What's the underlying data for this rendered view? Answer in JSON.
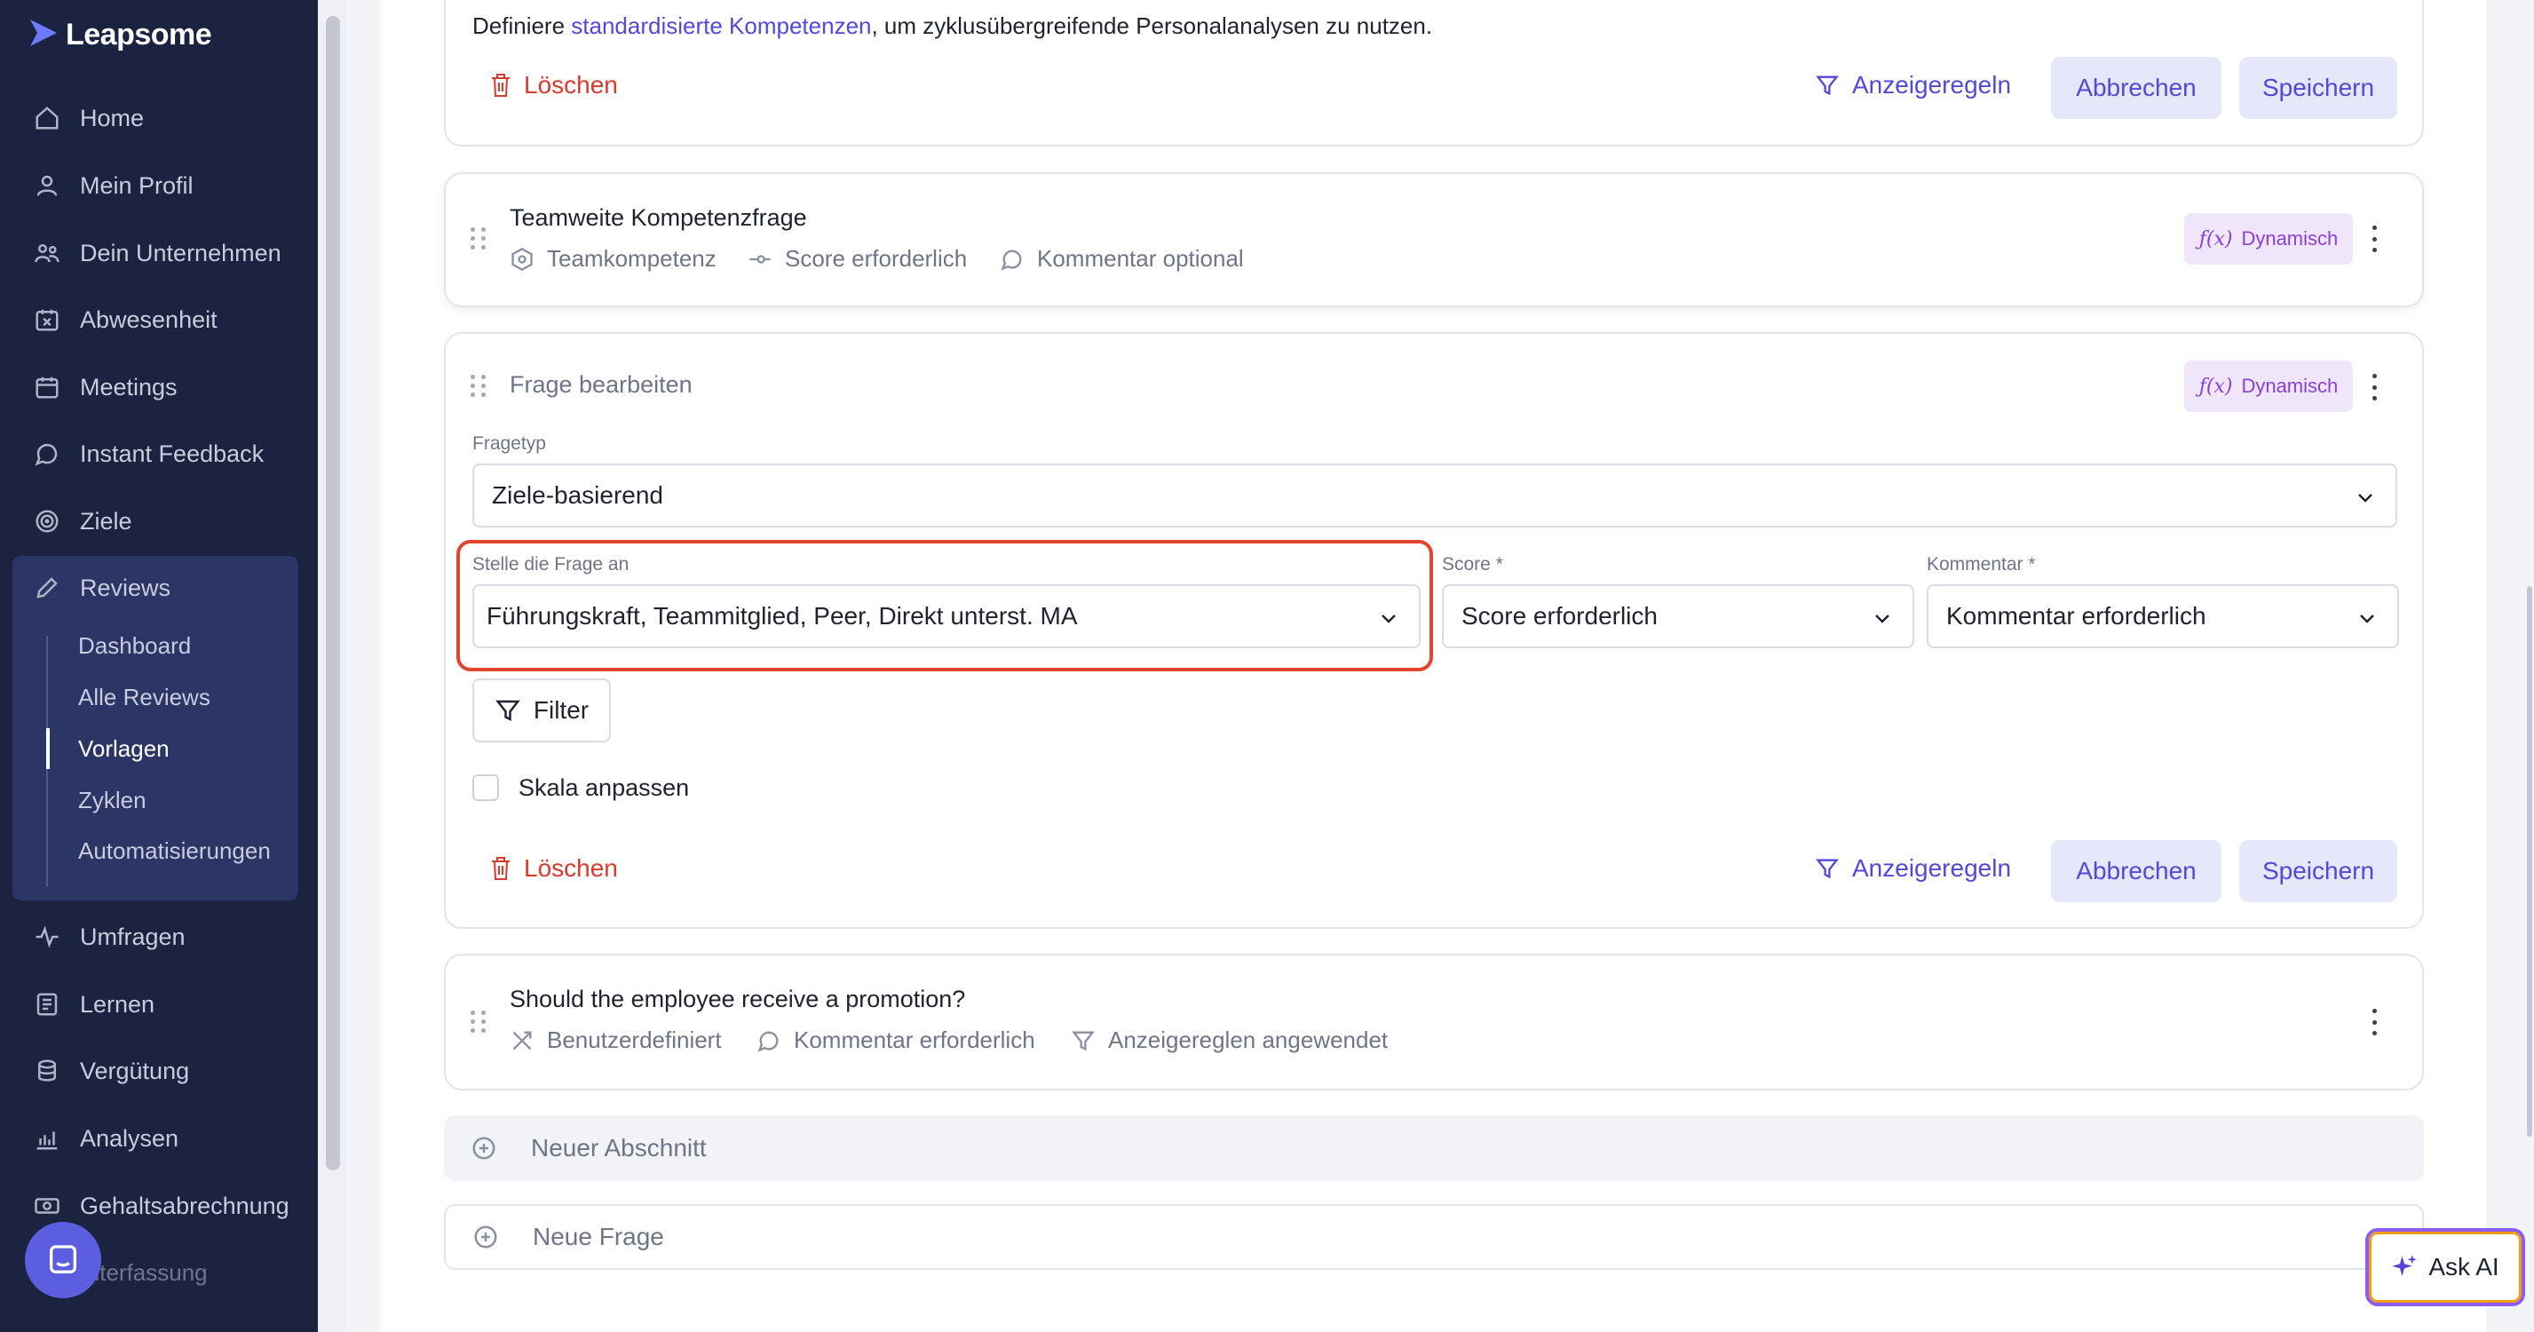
{
  "brand": {
    "name": "Leapsome"
  },
  "sidebar": {
    "items": [
      {
        "label": "Home"
      },
      {
        "label": "Mein Profil"
      },
      {
        "label": "Dein Unternehmen"
      },
      {
        "label": "Abwesenheit"
      },
      {
        "label": "Meetings"
      },
      {
        "label": "Instant Feedback"
      },
      {
        "label": "Ziele"
      },
      {
        "label": "Reviews"
      },
      {
        "label": "Umfragen"
      },
      {
        "label": "Lernen"
      },
      {
        "label": "Vergütung"
      },
      {
        "label": "Analysen"
      },
      {
        "label": "Gehaltsabrechnung"
      }
    ],
    "reviews_sub": [
      {
        "label": "Dashboard"
      },
      {
        "label": "Alle Reviews"
      },
      {
        "label": "Vorlagen"
      },
      {
        "label": "Zyklen"
      },
      {
        "label": "Automatisierungen"
      }
    ],
    "faded_item": "eiterfassung"
  },
  "top_card": {
    "intro_prefix": "Definiere ",
    "intro_link": "standardisierte Kompetenzen",
    "intro_suffix": ", um zyklusübergreifende Personalanalysen zu nutzen.",
    "delete": "Löschen",
    "display_rules": "Anzeigeregeln",
    "cancel": "Abbrechen",
    "save": "Speichern"
  },
  "team_question": {
    "title": "Teamweite Kompetenzfrage",
    "meta": [
      "Teamkompetenz",
      "Score erforderlich",
      "Kommentar optional"
    ],
    "badge": "Dynamisch"
  },
  "edit_question": {
    "title": "Frage bearbeiten",
    "badge": "Dynamisch",
    "type_label": "Fragetyp",
    "type_value": "Ziele-basierend",
    "ask_label": "Stelle die Frage an",
    "ask_value": "Führungskraft, Teammitglied, Peer, Direkt unterst. MA",
    "score_label": "Score *",
    "score_value": "Score erforderlich",
    "comment_label": "Kommentar *",
    "comment_value": "Kommentar erforderlich",
    "filter": "Filter",
    "scale_checkbox": "Skala anpassen",
    "delete": "Löschen",
    "display_rules": "Anzeigeregeln",
    "cancel": "Abbrechen",
    "save": "Speichern"
  },
  "promo_question": {
    "title": "Should the employee receive a promotion?",
    "meta": [
      "Benutzerdefiniert",
      "Kommentar erforderlich",
      "Anzeigereglen angewendet"
    ]
  },
  "new_section": "Neuer Abschnitt",
  "new_question": "Neue Frage",
  "ask_ai": "Ask AI",
  "colors": {
    "accent": "#5348dc",
    "danger": "#d93a2b",
    "sidebar": "#1c2340",
    "highlight": "#e0452f"
  }
}
